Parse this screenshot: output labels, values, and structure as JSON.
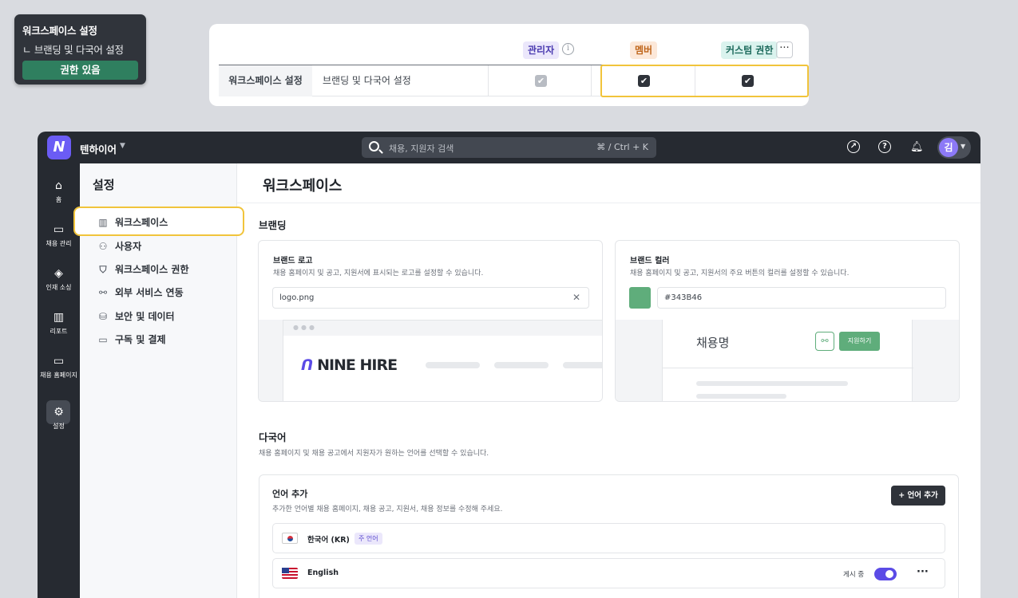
{
  "tooltip": {
    "title": "워크스페이스 설정",
    "subtitle": "ㄴ 브랜딩 및 다국어 설정",
    "badge": "권한 있음"
  },
  "permission_table": {
    "headers": {
      "admin": "관리자",
      "member": "멤버",
      "custom": "커스텀 권한",
      "info_icon": "i",
      "more": "···"
    },
    "row": {
      "category": "워크스페이스 설정",
      "item": "브랜딩 및 다국어 설정",
      "admin_checked": true,
      "member_checked": true,
      "custom_checked": true
    }
  },
  "topbar": {
    "logo": "N",
    "workspace": "텐하이어",
    "search_placeholder": "채용, 지원자 검색",
    "search_shortcut": "⌘ / Ctrl + K",
    "avatar_initial": "김"
  },
  "rail": [
    {
      "label": "홈",
      "icon": "home-icon",
      "glyph": "⌂"
    },
    {
      "label": "채용 관리",
      "icon": "job-icon",
      "glyph": "▭"
    },
    {
      "label": "인재 소싱",
      "icon": "layers-icon",
      "glyph": "◈"
    },
    {
      "label": "리포트",
      "icon": "report-icon",
      "glyph": "▥"
    },
    {
      "label": "채용 홈페이지",
      "icon": "monitor-icon",
      "glyph": "▭"
    },
    {
      "label": "설정",
      "icon": "gear-icon",
      "glyph": "⚙"
    }
  ],
  "sidebar": {
    "title": "설정",
    "items": [
      {
        "label": "워크스페이스",
        "glyph": "▥"
      },
      {
        "label": "사용자",
        "glyph": "⚇"
      },
      {
        "label": "워크스페이스 권한",
        "glyph": "⛉"
      },
      {
        "label": "외부 서비스 연동",
        "glyph": "⚯"
      },
      {
        "label": "보안 및 데이터",
        "glyph": "⛁"
      },
      {
        "label": "구독 및 결제",
        "glyph": "▭"
      }
    ]
  },
  "main": {
    "title": "워크스페이스",
    "branding": {
      "section": "브랜딩",
      "logo": {
        "title": "브랜드 로고",
        "desc": "채용 홈페이지 및 공고, 지원서에 표시되는 로고를 설정할 수 있습니다.",
        "file": "logo.png",
        "preview_logo": "NINE HIRE"
      },
      "color": {
        "title": "브랜드 컬러",
        "desc": "채용 홈페이지 및 공고, 지원서의 주요 버튼의 컬러를 설정할 수 있습니다.",
        "value": "#343B46",
        "swatch": "#5fad7b",
        "preview_title": "채용명",
        "preview_button": "지원하기"
      }
    },
    "multilang": {
      "section": "다국어",
      "desc": "채용 홈페이지 및 채용 공고에서 지원자가 원하는 언어를 선택할 수 있습니다.",
      "box_title": "언어 추가",
      "box_desc": "추가한 언어별 채용 홈페이지, 채용 공고, 지원서, 채용 정보를 수정해 주세요.",
      "add_button": "+ 언어 추가",
      "languages": [
        {
          "name": "한국어 (KR)",
          "tag": "주 언어"
        },
        {
          "name": "English",
          "status": "게시 중",
          "published": true
        }
      ]
    }
  }
}
